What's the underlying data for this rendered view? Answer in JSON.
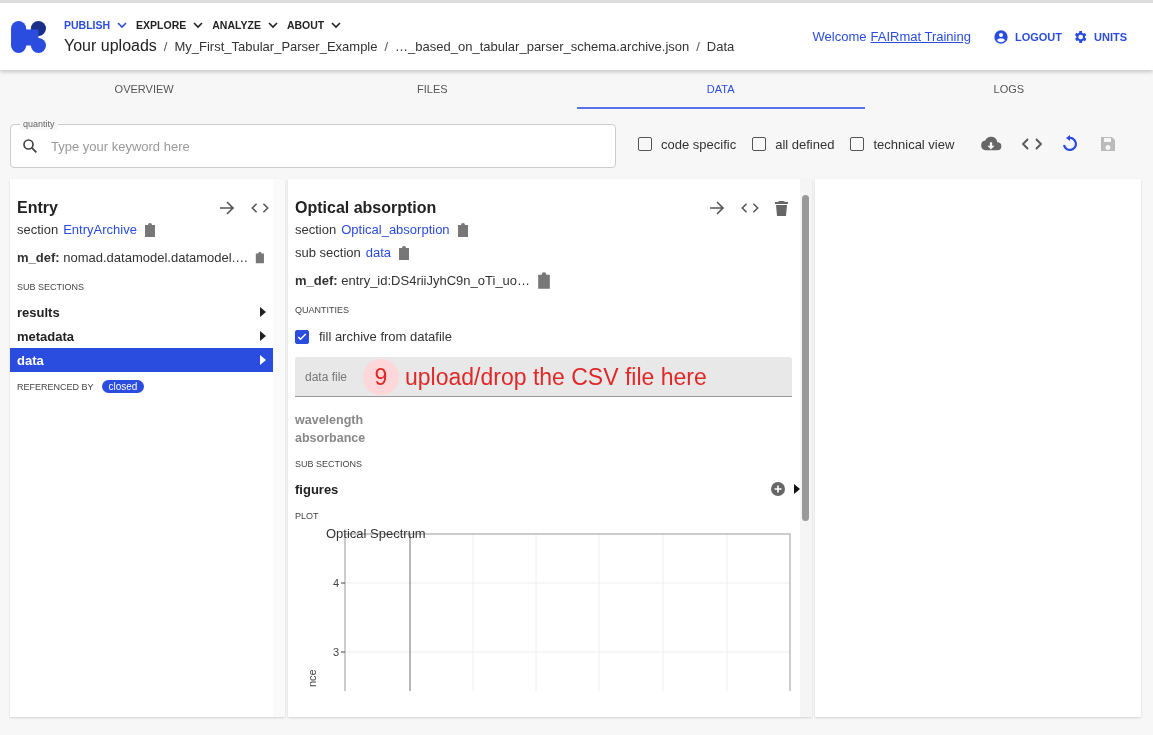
{
  "header": {
    "nav": [
      {
        "label": "PUBLISH",
        "selected": true
      },
      {
        "label": "EXPLORE",
        "selected": false
      },
      {
        "label": "ANALYZE",
        "selected": false
      },
      {
        "label": "ABOUT",
        "selected": false
      }
    ],
    "breadcrumbs": [
      "Your uploads",
      "My_First_Tabular_Parser_Example",
      "…_based_on_tabular_parser_schema.archive.json",
      "Data"
    ],
    "separator": "/",
    "welcome": "Welcome",
    "user": "FAIRmat Training",
    "actions": [
      {
        "kind": "logout",
        "label": "LOGOUT"
      },
      {
        "kind": "units",
        "label": "UNITS"
      }
    ]
  },
  "tabs": [
    {
      "label": "OVERVIEW",
      "selected": false
    },
    {
      "label": "FILES",
      "selected": false
    },
    {
      "label": "DATA",
      "selected": true
    },
    {
      "label": "LOGS",
      "selected": false
    }
  ],
  "search": {
    "label": "quantity",
    "placeholder": "Type your keyword here"
  },
  "filters": [
    {
      "label": "code specific",
      "checked": false
    },
    {
      "label": "all defined",
      "checked": false
    },
    {
      "label": "technical view",
      "checked": false
    }
  ],
  "entry_panel": {
    "title": "Entry",
    "section_label": "section",
    "section_link": "EntryArchive",
    "m_def_label": "m_def:",
    "m_def_value": "nomad.datamodel.datamodel.…",
    "subsections_heading": "SUB SECTIONS",
    "subsections": [
      {
        "label": "results",
        "selected": false
      },
      {
        "label": "metadata",
        "selected": false
      },
      {
        "label": "data",
        "selected": true
      }
    ],
    "referenced_by_label": "REFERENCED BY",
    "referenced_by_chip": "closed"
  },
  "data_panel": {
    "title": "Optical absorption",
    "section_label": "section",
    "section_link": "Optical_absorption",
    "subsection_label": "sub section",
    "subsection_link": "data",
    "m_def_label": "m_def:",
    "m_def_value": "entry_id:DS4riiJyhC9n_oTi_uo…",
    "quantities_heading": "QUANTITIES",
    "fill_checkbox": {
      "label": "fill archive from datafile",
      "checked": true
    },
    "data_file": {
      "label": "data file"
    },
    "annotation": {
      "number": "9",
      "text": "upload/drop the CSV file here"
    },
    "quantities": [
      "wavelength",
      "absorbance"
    ],
    "subsections_heading": "SUB SECTIONS",
    "subsections": [
      {
        "label": "figures"
      }
    ],
    "plot_heading": "PLOT",
    "plot": {
      "title": "Optical Spectrum",
      "ylabel": "nce",
      "yticks": [
        "4",
        "3"
      ]
    }
  }
}
